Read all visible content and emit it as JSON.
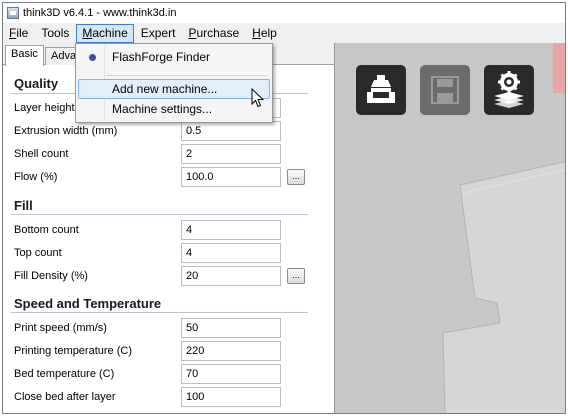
{
  "window": {
    "title": "think3D v6.4.1 - www.think3d.in"
  },
  "menubar": [
    {
      "mnemonic": "F",
      "rest": "ile"
    },
    {
      "mnemonic": "",
      "rest": "Tools"
    },
    {
      "mnemonic": "M",
      "rest": "achine"
    },
    {
      "mnemonic": "",
      "rest": "Expert"
    },
    {
      "mnemonic": "P",
      "rest": "urchase"
    },
    {
      "mnemonic": "H",
      "rest": "elp"
    }
  ],
  "machine_menu": {
    "items": [
      {
        "label": "FlashForge Finder",
        "selected": true
      },
      {
        "label": "Add new machine..."
      },
      {
        "label": "Machine settings..."
      }
    ]
  },
  "tabs": [
    "Basic",
    "Adva"
  ],
  "quality": {
    "title": "Quality",
    "fields": [
      {
        "label": "Layer height",
        "value": ""
      },
      {
        "label": "Extrusion width (mm)",
        "value": "0.5"
      },
      {
        "label": "Shell count",
        "value": "2"
      },
      {
        "label": "Flow (%)",
        "value": "100.0",
        "button": "..."
      }
    ]
  },
  "fill": {
    "title": "Fill",
    "fields": [
      {
        "label": "Bottom count",
        "value": "4"
      },
      {
        "label": "Top count",
        "value": "4"
      },
      {
        "label": "Fill Density (%)",
        "value": "20",
        "button": "..."
      }
    ]
  },
  "speed": {
    "title": "Speed and Temperature",
    "fields": [
      {
        "label": "Print speed (mm/s)",
        "value": "50"
      },
      {
        "label": "Printing temperature (C)",
        "value": "220"
      },
      {
        "label": "Bed temperature (C)",
        "value": "70"
      },
      {
        "label": "Close bed after layer",
        "value": "100"
      }
    ]
  },
  "viewport": {
    "buttons": [
      {
        "icon": "load-model-icon"
      },
      {
        "icon": "save-icon",
        "enabled": false
      },
      {
        "icon": "slice-settings-icon"
      }
    ]
  },
  "colors": {
    "menu_highlight": "#d5e6f8",
    "menu_highlight_border": "#3a7ed3",
    "viewport_bg": "#c7c7c7"
  }
}
